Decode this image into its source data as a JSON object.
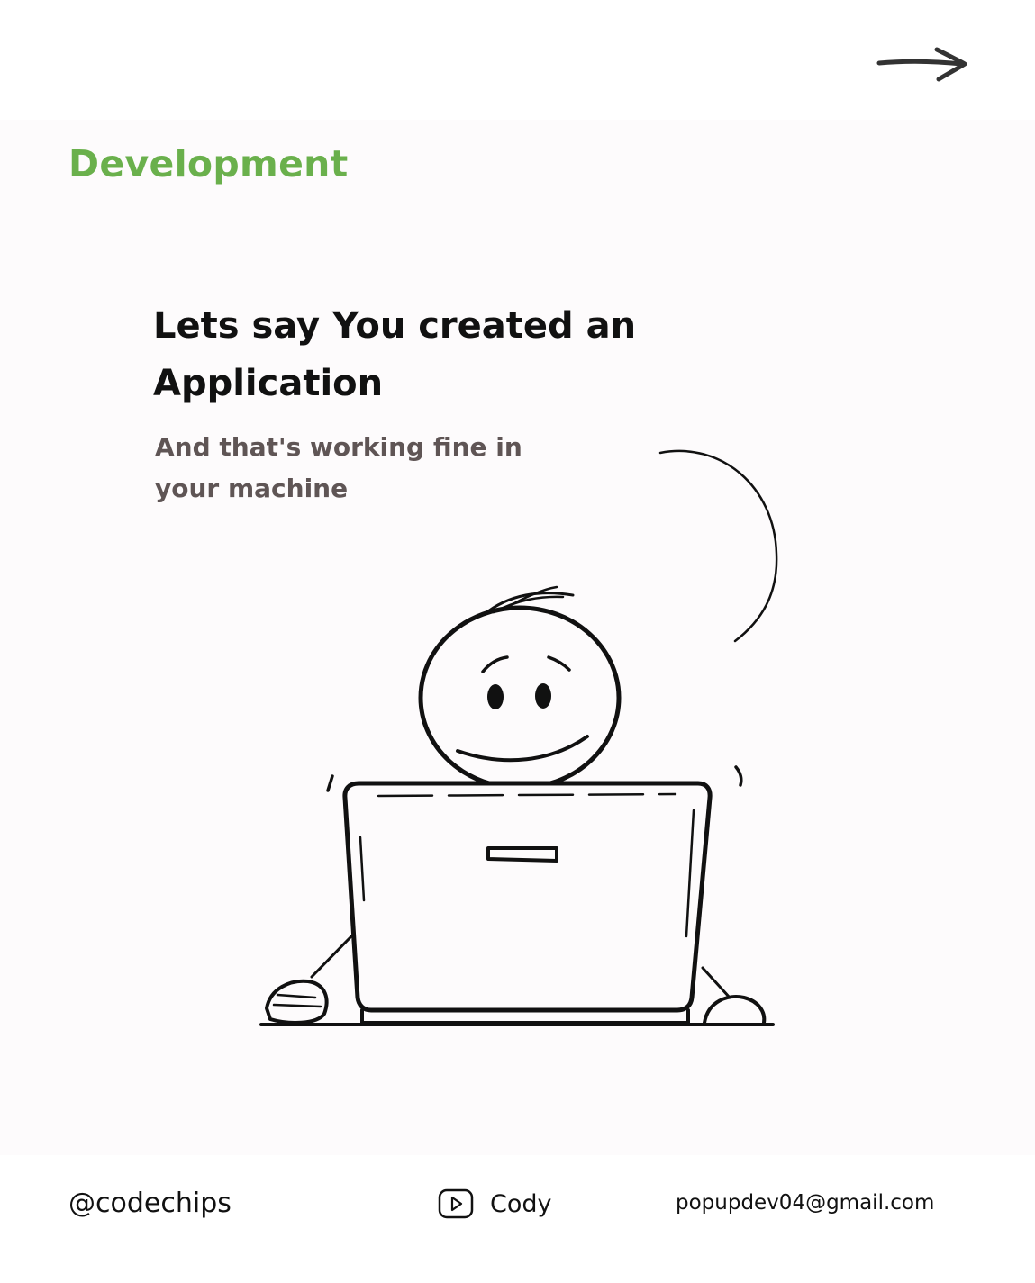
{
  "nav": {
    "next_icon": "arrow-right-icon"
  },
  "category": "Development",
  "headline": "Lets say You created an Application",
  "subtext": "And that's working fine in your machine",
  "illustration": {
    "icon": "stick-figure-laptop-illustration"
  },
  "footer": {
    "handle": "@codechips",
    "channel_icon": "youtube-play-icon",
    "channel_name": "Cody",
    "email": "popupdev04@gmail.com"
  },
  "colors": {
    "accent": "#6ab04c",
    "headline": "#111111",
    "subtext": "#5f5555",
    "panel": "#fdfbfc"
  }
}
